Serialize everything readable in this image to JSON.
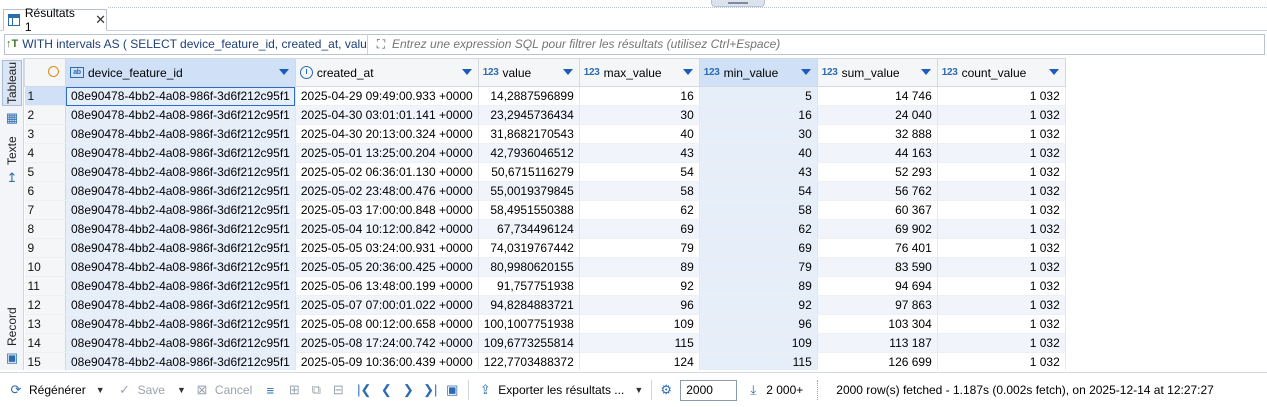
{
  "tab": {
    "label": "Résultats 1",
    "close": "✕"
  },
  "filter": {
    "sql_preview": "WITH intervals AS ( SELECT device_feature_id, created_at, value, N",
    "sql_prefix": "↑T",
    "placeholder": "Entrez une expression SQL pour filtrer les résultats (utilisez Ctrl+Espace)"
  },
  "side_tabs": {
    "tableau": "Tableau",
    "texte": "Texte",
    "record": "Record"
  },
  "columns": [
    {
      "name": "device_feature_id",
      "type": "str"
    },
    {
      "name": "created_at",
      "type": "clock"
    },
    {
      "name": "value",
      "type": "123"
    },
    {
      "name": "max_value",
      "type": "123"
    },
    {
      "name": "min_value",
      "type": "123"
    },
    {
      "name": "sum_value",
      "type": "123"
    },
    {
      "name": "count_value",
      "type": "123"
    }
  ],
  "rows": [
    [
      "1",
      "08e90478-4bb2-4a08-986f-3d6f212c95f1",
      "2025-04-29 09:49:00.933 +0000",
      "14,2887596899",
      "16",
      "5",
      "14 746",
      "1 032"
    ],
    [
      "2",
      "08e90478-4bb2-4a08-986f-3d6f212c95f1",
      "2025-04-30 03:01:01.141 +0000",
      "23,2945736434",
      "30",
      "16",
      "24 040",
      "1 032"
    ],
    [
      "3",
      "08e90478-4bb2-4a08-986f-3d6f212c95f1",
      "2025-04-30 20:13:00.324 +0000",
      "31,8682170543",
      "40",
      "30",
      "32 888",
      "1 032"
    ],
    [
      "4",
      "08e90478-4bb2-4a08-986f-3d6f212c95f1",
      "2025-05-01 13:25:00.204 +0000",
      "42,7936046512",
      "43",
      "40",
      "44 163",
      "1 032"
    ],
    [
      "5",
      "08e90478-4bb2-4a08-986f-3d6f212c95f1",
      "2025-05-02 06:36:01.130 +0000",
      "50,6715116279",
      "54",
      "43",
      "52 293",
      "1 032"
    ],
    [
      "6",
      "08e90478-4bb2-4a08-986f-3d6f212c95f1",
      "2025-05-02 23:48:00.476 +0000",
      "55,0019379845",
      "58",
      "54",
      "56 762",
      "1 032"
    ],
    [
      "7",
      "08e90478-4bb2-4a08-986f-3d6f212c95f1",
      "2025-05-03 17:00:00.848 +0000",
      "58,4951550388",
      "62",
      "58",
      "60 367",
      "1 032"
    ],
    [
      "8",
      "08e90478-4bb2-4a08-986f-3d6f212c95f1",
      "2025-05-04 10:12:00.842 +0000",
      "67,734496124",
      "69",
      "62",
      "69 902",
      "1 032"
    ],
    [
      "9",
      "08e90478-4bb2-4a08-986f-3d6f212c95f1",
      "2025-05-05 03:24:00.931 +0000",
      "74,0319767442",
      "79",
      "69",
      "76 401",
      "1 032"
    ],
    [
      "10",
      "08e90478-4bb2-4a08-986f-3d6f212c95f1",
      "2025-05-05 20:36:00.425 +0000",
      "80,9980620155",
      "89",
      "79",
      "83 590",
      "1 032"
    ],
    [
      "11",
      "08e90478-4bb2-4a08-986f-3d6f212c95f1",
      "2025-05-06 13:48:00.199 +0000",
      "91,757751938",
      "92",
      "89",
      "94 694",
      "1 032"
    ],
    [
      "12",
      "08e90478-4bb2-4a08-986f-3d6f212c95f1",
      "2025-05-07 07:00:01.022 +0000",
      "94,8284883721",
      "96",
      "92",
      "97 863",
      "1 032"
    ],
    [
      "13",
      "08e90478-4bb2-4a08-986f-3d6f212c95f1",
      "2025-05-08 00:12:00.658 +0000",
      "100,1007751938",
      "109",
      "96",
      "103 304",
      "1 032"
    ],
    [
      "14",
      "08e90478-4bb2-4a08-986f-3d6f212c95f1",
      "2025-05-08 17:24:00.742 +0000",
      "109,6773255814",
      "115",
      "109",
      "113 187",
      "1 032"
    ],
    [
      "15",
      "08e90478-4bb2-4a08-986f-3d6f212c95f1",
      "2025-05-09 10:36:00.439 +0000",
      "122,7703488372",
      "124",
      "115",
      "126 699",
      "1 032"
    ]
  ],
  "toolbar": {
    "regenerate": "Régénérer",
    "save": "Save",
    "cancel": "Cancel",
    "export": "Exporter les résultats ...",
    "fetch_size": "2000",
    "fetch_all": "2 000+",
    "status": "2000 row(s) fetched - 1.187s (0.002s fetch), on 2025-12-14 at 12:27:27"
  }
}
